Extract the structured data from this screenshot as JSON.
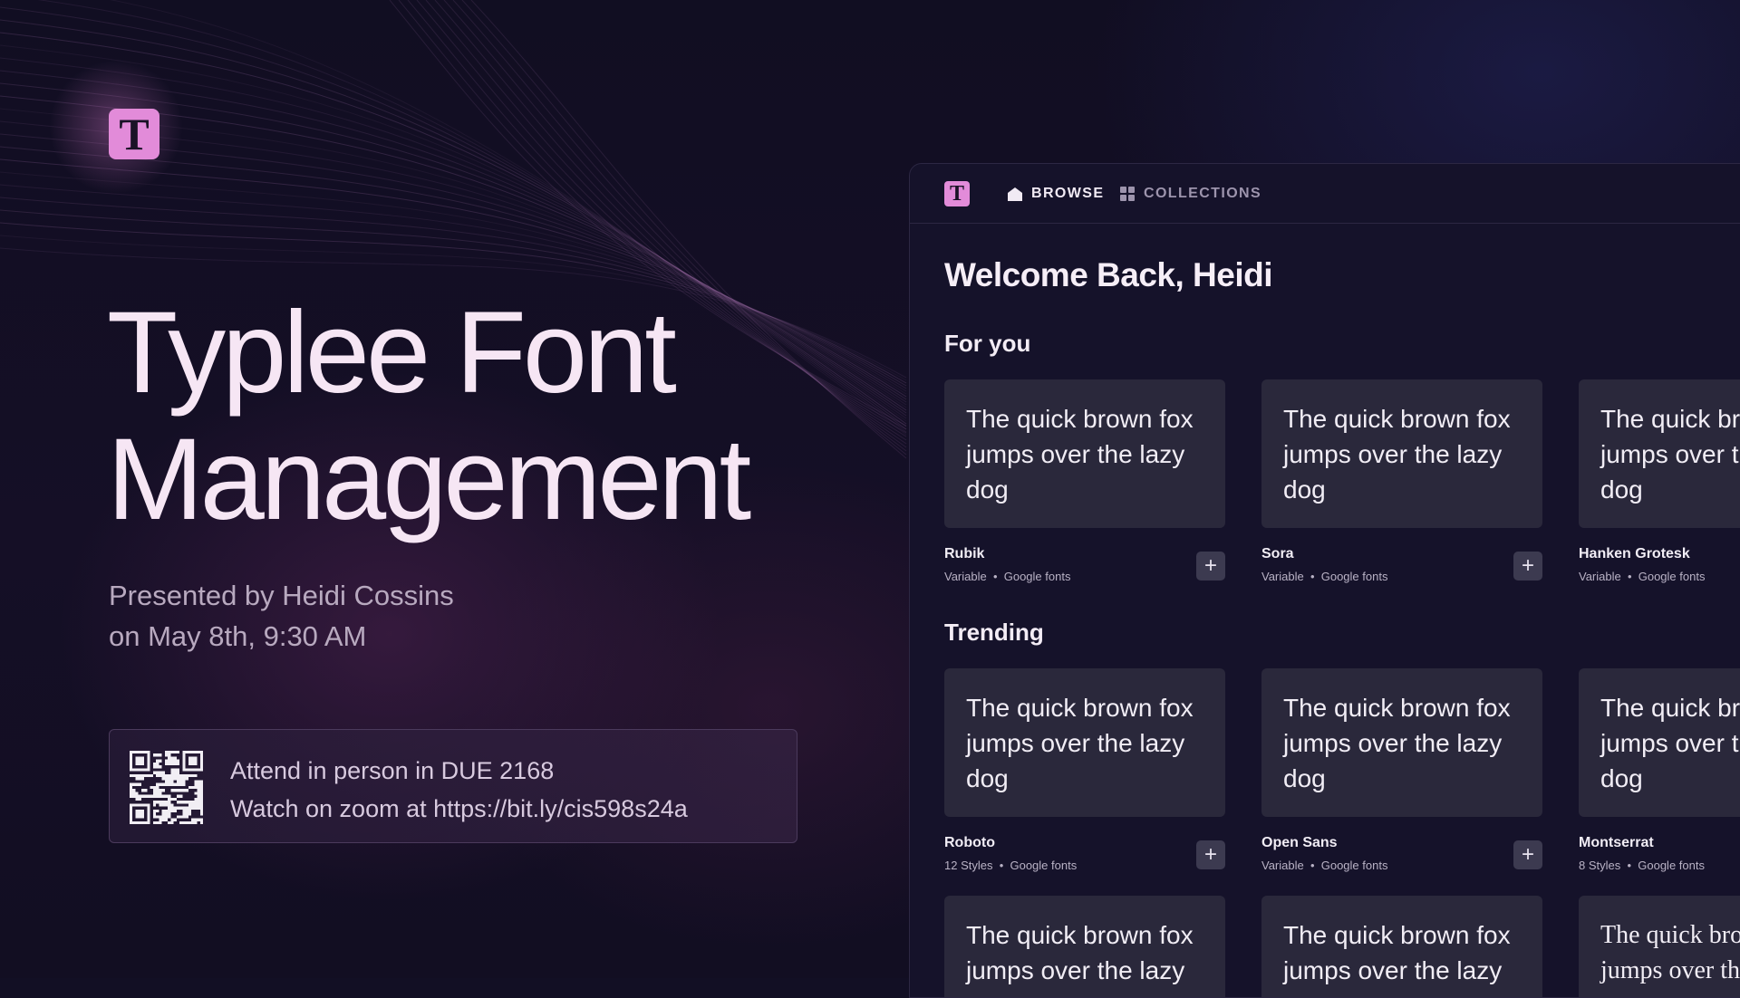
{
  "logo": {
    "letter": "T"
  },
  "hero": {
    "title_line1": "Typlee Font",
    "title_line2": "Management",
    "presenter": "Presented by Heidi Cossins",
    "date": "on May 8th, 9:30 AM"
  },
  "info": {
    "line1": "Attend in person in DUE 2168",
    "line2": "Watch on zoom at https://bit.ly/cis598s24a"
  },
  "app": {
    "logo_letter": "T",
    "nav": {
      "browse": "BROWSE",
      "collections": "COLLECTIONS"
    },
    "welcome": "Welcome Back, Heidi",
    "sections": {
      "for_you": "For you",
      "trending": "Trending"
    },
    "add_label": "+",
    "for_you": [
      {
        "preview": "The quick brown fox jumps over the lazy dog",
        "name": "Rubik",
        "styles": "Variable",
        "source": "Google fonts"
      },
      {
        "preview": "The quick brown fox jumps over the lazy dog",
        "name": "Sora",
        "styles": "Variable",
        "source": "Google fonts"
      },
      {
        "preview": "The quick brown fox jumps over the lazy dog",
        "name": "Hanken Grotesk",
        "styles": "Variable",
        "source": "Google fonts"
      }
    ],
    "trending": [
      {
        "preview": "The quick brown fox jumps over the lazy dog",
        "name": "Roboto",
        "styles": "12 Styles",
        "source": "Google fonts"
      },
      {
        "preview": "The quick brown fox jumps over the lazy dog",
        "name": "Open Sans",
        "styles": "Variable",
        "source": "Google fonts"
      },
      {
        "preview": "The quick brown fox jumps over the lazy dog",
        "name": "Montserrat",
        "styles": "8 Styles",
        "source": "Google fonts"
      }
    ],
    "more": [
      {
        "preview": "The quick brown fox jumps over the lazy"
      },
      {
        "preview": "The quick brown fox jumps over the lazy"
      },
      {
        "preview": "The quick brown fox jumps over the lazy"
      }
    ]
  },
  "colors": {
    "accent": "#e28bd9",
    "background": "#120f24",
    "card": "#2a283b"
  }
}
